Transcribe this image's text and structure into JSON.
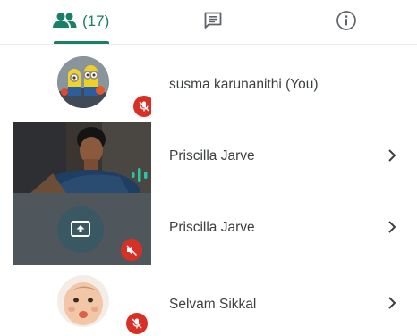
{
  "tabs": {
    "people": {
      "icon": "people-icon",
      "count_label": "(17)",
      "selected": true
    },
    "chat": {
      "icon": "chat-icon"
    },
    "info": {
      "icon": "info-icon"
    }
  },
  "participants": [
    {
      "name": "susma karunanithi (You)",
      "tile": "avatar",
      "avatar": "cartoon-minions-avatar",
      "mic": "muted",
      "chevron": false
    },
    {
      "name": "Priscilla Jarve",
      "tile": "video",
      "mic": "speaking",
      "chevron": true
    },
    {
      "name": "Priscilla Jarve",
      "tile": "screen-share",
      "mic": "muted",
      "chevron": true
    },
    {
      "name": "Selvam Sikkal",
      "tile": "avatar",
      "avatar": "baby-photo-avatar",
      "mic": "muted",
      "chevron": true
    }
  ],
  "colors": {
    "accent": "#1a7f67",
    "mute_red": "#d93025",
    "text": "#3c4043",
    "icon_gray": "#5f6368",
    "speaking_teal": "#28c7a7"
  }
}
